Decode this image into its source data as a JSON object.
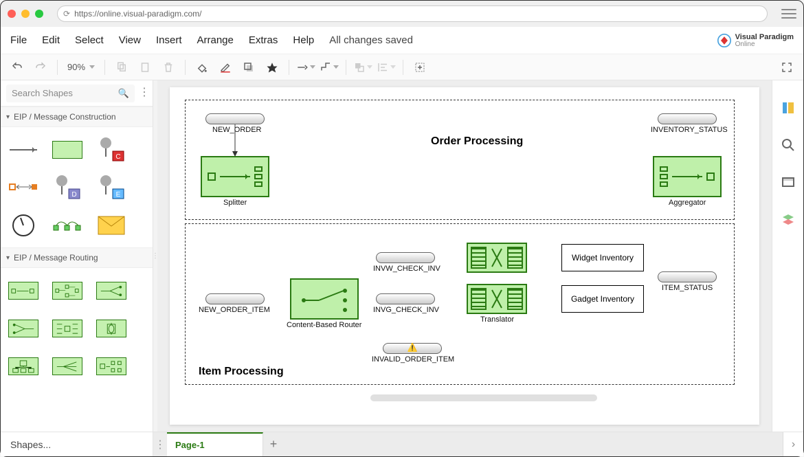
{
  "url": "https://online.visual-paradigm.com/",
  "brand": {
    "line1": "Visual Paradigm",
    "line2": "Online"
  },
  "menus": [
    "File",
    "Edit",
    "Select",
    "View",
    "Insert",
    "Arrange",
    "Extras",
    "Help"
  ],
  "save_status": "All changes saved",
  "toolbar": {
    "zoom": "90%"
  },
  "sidebar": {
    "search_placeholder": "Search Shapes",
    "panels": [
      {
        "title": "EIP / Message Construction"
      },
      {
        "title": "EIP / Message Routing"
      }
    ],
    "shapes_link": "Shapes..."
  },
  "diagram": {
    "regions": {
      "order": {
        "title": "Order Processing"
      },
      "item": {
        "title": "Item Processing"
      }
    },
    "pipes": {
      "new_order": "NEW_ORDER",
      "inventory_status": "INVENTORY_STATUS",
      "new_order_item": "NEW_ORDER_ITEM",
      "invw": "INVW_CHECK_INV",
      "invg": "INVG_CHECK_INV",
      "invalid": "INVALID_ORDER_ITEM",
      "item_status": "ITEM_STATUS"
    },
    "nodes": {
      "splitter": "Splitter",
      "aggregator": "Aggregator",
      "router": "Content-Based Router",
      "translator": "Translator",
      "widget": "Widget Inventory",
      "gadget": "Gadget Inventory"
    }
  },
  "footer": {
    "page_tab": "Page-1"
  }
}
